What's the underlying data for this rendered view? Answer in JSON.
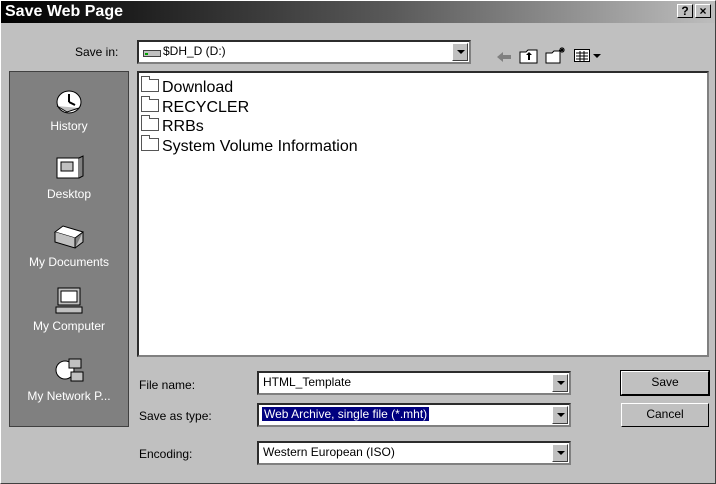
{
  "window": {
    "title": "Save Web Page",
    "help_button": "?",
    "close_button": "×"
  },
  "save_in": {
    "label": "Save in:",
    "value": "$DH_D (D:)"
  },
  "toolbar": {
    "back_icon": "back-arrow-icon",
    "up_icon": "up-folder-icon",
    "new_folder_icon": "new-folder-icon",
    "views_icon": "views-menu-icon"
  },
  "places": [
    {
      "label": "History",
      "icon": "history-icon"
    },
    {
      "label": "Desktop",
      "icon": "desktop-icon"
    },
    {
      "label": "My Documents",
      "icon": "my-documents-icon"
    },
    {
      "label": "My Computer",
      "icon": "my-computer-icon"
    },
    {
      "label": "My Network P...",
      "icon": "my-network-places-icon"
    }
  ],
  "files": [
    {
      "name": "Download"
    },
    {
      "name": "RECYCLER"
    },
    {
      "name": "RRBs"
    },
    {
      "name": "System Volume Information"
    }
  ],
  "form": {
    "file_name_label": "File name:",
    "file_name_value": "HTML_Template",
    "save_type_label": "Save as type:",
    "save_type_value": "Web Archive, single file (*.mht)",
    "encoding_label": "Encoding:",
    "encoding_value": "Western European (ISO)"
  },
  "buttons": {
    "save": "Save",
    "cancel": "Cancel"
  }
}
